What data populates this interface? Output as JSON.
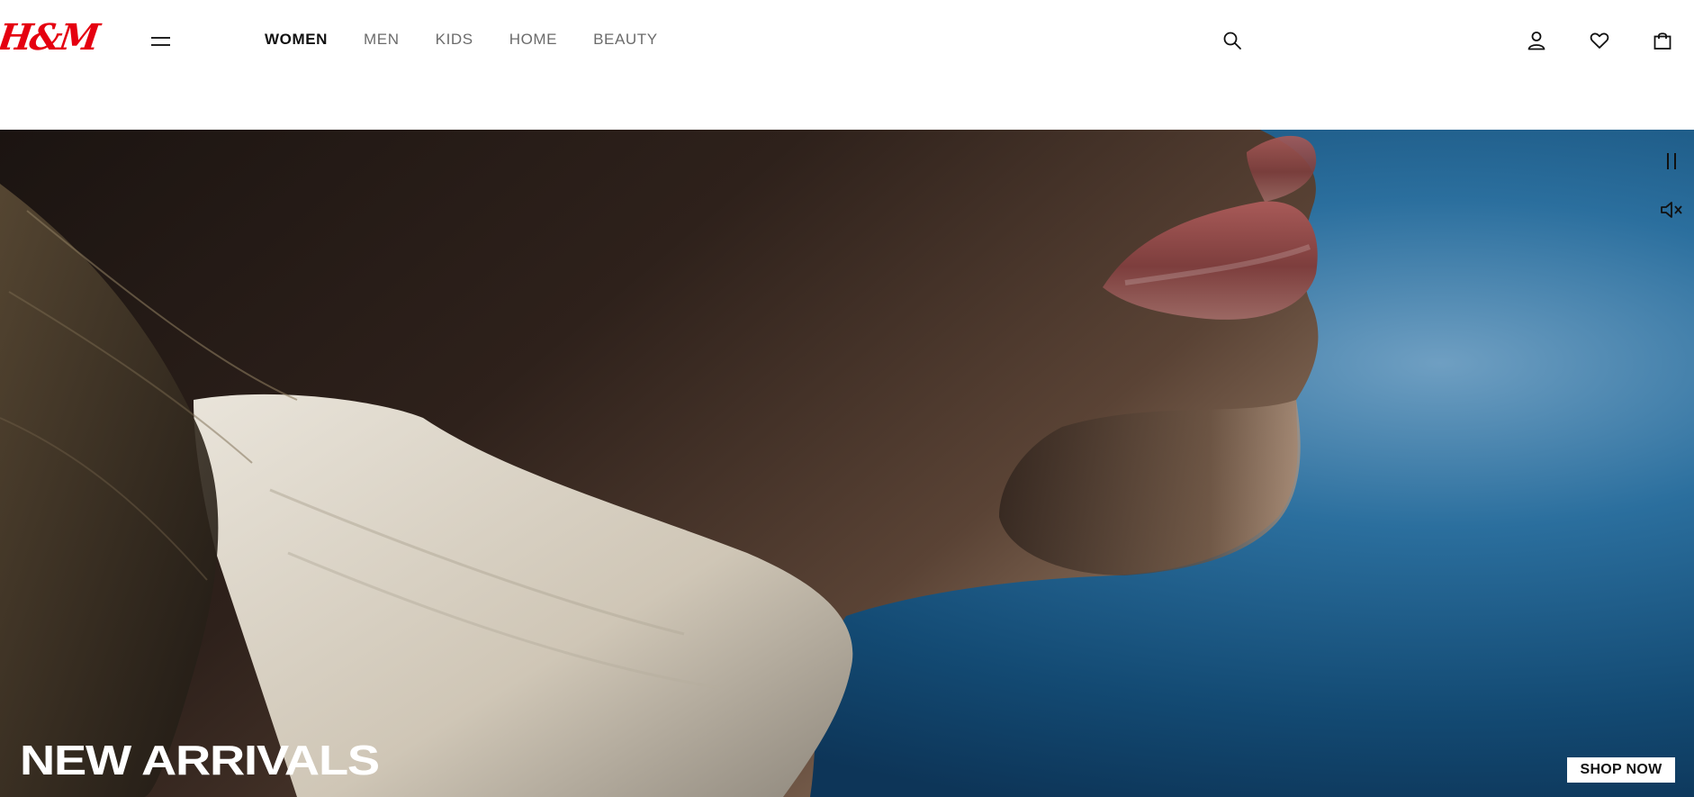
{
  "brand": {
    "logo_text": "H&M",
    "color": "#e50010"
  },
  "nav": {
    "items": [
      {
        "label": "WOMEN",
        "active": true
      },
      {
        "label": "MEN"
      },
      {
        "label": "KIDS"
      },
      {
        "label": "HOME"
      },
      {
        "label": "BEAUTY"
      }
    ]
  },
  "header_actions": {
    "search_icon": "search-icon",
    "account_icon": "user-icon",
    "favourites_icon": "heart-icon",
    "bag_icon": "shopping-bag-icon"
  },
  "hero": {
    "title": "NEW ARRIVALS",
    "cta_label": "SHOP NOW",
    "pause_icon": "pause-icon",
    "mute_icon": "muted-speaker-icon",
    "colors": {
      "text": "#ffffff",
      "sky": "#1d5a86",
      "skin": "#3a2a22"
    }
  }
}
